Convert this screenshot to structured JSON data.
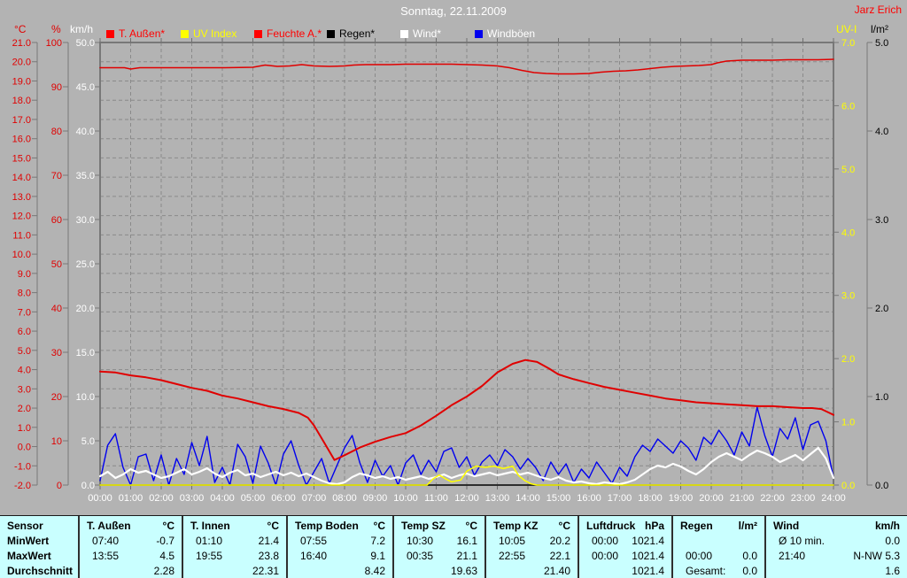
{
  "title": "Sonntag, 22.11.2009",
  "signature": "Jarz Erich",
  "colors": {
    "background": "#b3b3b3",
    "grid": "#8a8a8a",
    "plot_border": "#787878",
    "table_background": "#c9ffff",
    "red": "#e00000",
    "yellow": "#ffff00",
    "white": "#ffffff",
    "blue": "#0000ee",
    "black": "#000000"
  },
  "legend": {
    "items": [
      {
        "label": "T. Außen*",
        "swatch": "#ff0000",
        "text": "#ff0000"
      },
      {
        "label": "UV Index",
        "swatch": "#ffff00",
        "text": "#ffff00"
      },
      {
        "label": "Feuchte A.*",
        "swatch": "#ff0000",
        "text": "#ff0000"
      },
      {
        "label": "Regen*",
        "swatch": "#000000",
        "text": "#000000"
      },
      {
        "label": "Wind*",
        "swatch": "#ffffff",
        "text": "#ffffff"
      },
      {
        "label": "Windböen",
        "swatch": "#0000ee",
        "text": "#ffffff"
      }
    ]
  },
  "chart_data": {
    "type": "line",
    "title": "Sonntag, 22.11.2009",
    "grid": {
      "v_divisions": 24,
      "h_divisions": 23,
      "style": "dashed"
    },
    "x_axis": {
      "min": 0,
      "max": 24,
      "tick_labels": [
        "00:00",
        "01:00",
        "02:00",
        "03:00",
        "04:00",
        "05:00",
        "06:00",
        "07:00",
        "08:00",
        "09:00",
        "10:00",
        "11:00",
        "12:00",
        "13:00",
        "14:00",
        "15:00",
        "16:00",
        "17:00",
        "18:00",
        "19:00",
        "20:00",
        "21:00",
        "22:00",
        "23:00",
        "24:00"
      ]
    },
    "axes": [
      {
        "id": "temp",
        "unit": "°C",
        "color": "#e00000",
        "min": -2,
        "max": 21,
        "ticks": [
          "21.0",
          "20.0",
          "19.0",
          "18.0",
          "17.0",
          "16.0",
          "15.0",
          "14.0",
          "13.0",
          "12.0",
          "11.0",
          "10.0",
          "9.0",
          "8.0",
          "7.0",
          "6.0",
          "5.0",
          "4.0",
          "3.0",
          "2.0",
          "1.0",
          "0.0",
          "-1.0",
          "-2.0"
        ]
      },
      {
        "id": "humidity",
        "unit": "%",
        "color": "#e00000",
        "min": 0,
        "max": 100,
        "ticks": [
          "100",
          "90",
          "80",
          "70",
          "60",
          "50",
          "40",
          "30",
          "20",
          "10",
          "0"
        ]
      },
      {
        "id": "wind",
        "unit": "km/h",
        "color": "#ffffff",
        "min": 0,
        "max": 50,
        "ticks": [
          "50.0",
          "45.0",
          "40.0",
          "35.0",
          "30.0",
          "25.0",
          "20.0",
          "15.0",
          "10.0",
          "5.0",
          "0.0"
        ]
      },
      {
        "id": "uv",
        "unit": "UV-I",
        "color": "#ffff00",
        "min": 0,
        "max": 7,
        "ticks": [
          "7.0",
          "6.0",
          "5.0",
          "4.0",
          "3.0",
          "2.0",
          "1.0",
          "0.0"
        ]
      },
      {
        "id": "rain",
        "unit": "l/m²",
        "color": "#000000",
        "min": 0,
        "max": 5,
        "ticks": [
          "5.0",
          "4.0",
          "3.0",
          "2.0",
          "1.0",
          "0.0"
        ]
      }
    ],
    "series": [
      {
        "name": "Regen*",
        "axis": "rain",
        "color": "#000000",
        "width": 1.2,
        "points": [
          [
            0,
            0
          ],
          [
            24,
            0
          ]
        ]
      },
      {
        "name": "Windböen",
        "axis": "wind",
        "color": "#0000ee",
        "width": 1.4,
        "start": 0,
        "step": 0.25,
        "values": [
          0.5,
          4.5,
          5.8,
          2.0,
          0.0,
          3.2,
          3.5,
          0.5,
          3.4,
          0.0,
          3.0,
          1.2,
          4.8,
          2.2,
          5.5,
          0.3,
          2.0,
          0.0,
          4.6,
          3.2,
          0.2,
          4.4,
          2.5,
          0.0,
          3.5,
          5.0,
          2.2,
          0.0,
          1.5,
          3.0,
          0.2,
          2.2,
          4.2,
          5.6,
          2.5,
          0.3,
          2.8,
          1.0,
          2.2,
          0.0,
          2.5,
          3.4,
          1.2,
          2.8,
          1.5,
          3.8,
          4.2,
          2.0,
          3.2,
          1.1,
          2.6,
          3.4,
          2.2,
          4.0,
          3.2,
          1.8,
          3.0,
          2.0,
          0.5,
          2.6,
          1.2,
          2.4,
          0.3,
          1.8,
          0.8,
          2.6,
          1.4,
          0.2,
          2.0,
          1.0,
          3.2,
          4.5,
          3.8,
          5.2,
          4.4,
          3.6,
          5.0,
          4.2,
          2.8,
          5.4,
          4.6,
          6.2,
          5.0,
          3.4,
          6.0,
          4.4,
          8.8,
          5.6,
          3.2,
          6.4,
          5.2,
          7.6,
          4.0,
          6.8,
          7.2,
          5.0,
          0.8
        ]
      },
      {
        "name": "Wind*",
        "axis": "wind",
        "color": "#ffffff",
        "width": 2.2,
        "start": 0,
        "step": 0.25,
        "values": [
          1.0,
          1.5,
          0.8,
          1.2,
          1.8,
          1.4,
          1.6,
          1.2,
          0.8,
          1.0,
          1.4,
          1.8,
          1.2,
          1.5,
          1.9,
          1.3,
          0.9,
          1.4,
          1.7,
          1.1,
          1.3,
          0.9,
          1.2,
          1.5,
          1.1,
          1.4,
          1.0,
          1.3,
          0.9,
          0.5,
          0.2,
          0.1,
          0.3,
          0.9,
          1.3,
          1.1,
          0.8,
          1.0,
          0.7,
          0.9,
          0.6,
          0.8,
          1.0,
          0.7,
          0.9,
          1.2,
          0.8,
          1.1,
          1.3,
          1.0,
          1.2,
          1.4,
          1.1,
          1.3,
          1.5,
          1.2,
          1.4,
          1.1,
          0.8,
          0.6,
          0.9,
          0.5,
          0.3,
          0.4,
          0.2,
          0.1,
          0.3,
          0.2,
          0.1,
          0.3,
          0.6,
          1.2,
          1.8,
          2.2,
          2.0,
          2.4,
          2.1,
          1.6,
          1.2,
          1.8,
          2.6,
          3.2,
          3.6,
          3.2,
          2.8,
          3.4,
          3.9,
          3.6,
          3.2,
          2.6,
          3.0,
          3.4,
          2.8,
          3.5,
          4.2,
          3.0,
          0.8
        ]
      },
      {
        "name": "UV Index",
        "axis": "uv",
        "color": "#ffff00",
        "width": 1.5,
        "points": [
          [
            0,
            0
          ],
          [
            10.7,
            0
          ],
          [
            10.9,
            0.1
          ],
          [
            11.1,
            0.16
          ],
          [
            11.3,
            0.1
          ],
          [
            11.5,
            0.05
          ],
          [
            11.8,
            0.08
          ],
          [
            12,
            0.22
          ],
          [
            12.3,
            0.3
          ],
          [
            12.6,
            0.28
          ],
          [
            12.9,
            0.3
          ],
          [
            13.2,
            0.26
          ],
          [
            13.5,
            0.3
          ],
          [
            13.7,
            0.15
          ],
          [
            13.9,
            0.07
          ],
          [
            14.1,
            0.02
          ],
          [
            14.3,
            0
          ],
          [
            24,
            0
          ]
        ]
      },
      {
        "name": "Feuchte A.*",
        "axis": "humidity",
        "color": "#e00000",
        "width": 1.5,
        "points": [
          [
            0,
            94.3
          ],
          [
            0.8,
            94.3
          ],
          [
            1,
            94.0
          ],
          [
            1.3,
            94.3
          ],
          [
            2,
            94.3
          ],
          [
            3,
            94.3
          ],
          [
            4,
            94.3
          ],
          [
            5,
            94.4
          ],
          [
            5.4,
            94.9
          ],
          [
            5.8,
            94.6
          ],
          [
            6.2,
            94.7
          ],
          [
            6.6,
            95.0
          ],
          [
            7,
            94.7
          ],
          [
            7.5,
            94.6
          ],
          [
            8,
            94.7
          ],
          [
            8.3,
            94.9
          ],
          [
            8.7,
            95.0
          ],
          [
            9,
            95.0
          ],
          [
            9.5,
            95.0
          ],
          [
            10,
            95.1
          ],
          [
            10.5,
            95.1
          ],
          [
            11,
            95.1
          ],
          [
            11.5,
            95.1
          ],
          [
            12,
            95.0
          ],
          [
            12.5,
            94.9
          ],
          [
            13,
            94.7
          ],
          [
            13.4,
            94.3
          ],
          [
            13.8,
            93.7
          ],
          [
            14.2,
            93.2
          ],
          [
            14.6,
            93.0
          ],
          [
            15,
            92.9
          ],
          [
            15.5,
            92.9
          ],
          [
            16,
            93.0
          ],
          [
            16.4,
            93.3
          ],
          [
            16.8,
            93.5
          ],
          [
            17.2,
            93.6
          ],
          [
            17.6,
            93.8
          ],
          [
            18,
            94.1
          ],
          [
            18.4,
            94.4
          ],
          [
            18.8,
            94.6
          ],
          [
            19.2,
            94.7
          ],
          [
            19.6,
            94.8
          ],
          [
            20,
            95.0
          ],
          [
            20.2,
            95.4
          ],
          [
            20.5,
            95.8
          ],
          [
            21,
            96.0
          ],
          [
            21.5,
            96.0
          ],
          [
            22,
            96.0
          ],
          [
            22.5,
            96.1
          ],
          [
            23,
            96.1
          ],
          [
            23.5,
            96.1
          ],
          [
            24,
            96.2
          ]
        ]
      },
      {
        "name": "T. Außen*",
        "axis": "temp",
        "color": "#e00000",
        "width": 2,
        "points": [
          [
            0,
            3.9
          ],
          [
            0.5,
            3.85
          ],
          [
            1,
            3.7
          ],
          [
            1.5,
            3.6
          ],
          [
            2,
            3.45
          ],
          [
            2.5,
            3.25
          ],
          [
            3,
            3.05
          ],
          [
            3.5,
            2.9
          ],
          [
            4,
            2.65
          ],
          [
            4.5,
            2.5
          ],
          [
            5,
            2.3
          ],
          [
            5.5,
            2.1
          ],
          [
            6,
            1.95
          ],
          [
            6.5,
            1.75
          ],
          [
            6.8,
            1.5
          ],
          [
            7,
            1.1
          ],
          [
            7.3,
            0.3
          ],
          [
            7.67,
            -0.7
          ],
          [
            8,
            -0.45
          ],
          [
            8.5,
            -0.05
          ],
          [
            9,
            0.25
          ],
          [
            9.5,
            0.5
          ],
          [
            10,
            0.7
          ],
          [
            10.5,
            1.1
          ],
          [
            11,
            1.6
          ],
          [
            11.5,
            2.15
          ],
          [
            12,
            2.6
          ],
          [
            12.5,
            3.15
          ],
          [
            13,
            3.85
          ],
          [
            13.5,
            4.3
          ],
          [
            13.92,
            4.5
          ],
          [
            14.3,
            4.4
          ],
          [
            14.7,
            4.05
          ],
          [
            15,
            3.75
          ],
          [
            15.5,
            3.5
          ],
          [
            16,
            3.3
          ],
          [
            16.5,
            3.1
          ],
          [
            17,
            2.95
          ],
          [
            17.5,
            2.8
          ],
          [
            18,
            2.65
          ],
          [
            18.5,
            2.5
          ],
          [
            19,
            2.4
          ],
          [
            19.5,
            2.3
          ],
          [
            20,
            2.25
          ],
          [
            20.5,
            2.2
          ],
          [
            21,
            2.15
          ],
          [
            21.5,
            2.1
          ],
          [
            22,
            2.1
          ],
          [
            22.5,
            2.05
          ],
          [
            23,
            2.0
          ],
          [
            23.3,
            2.0
          ],
          [
            23.6,
            1.95
          ],
          [
            23.8,
            1.8
          ],
          [
            24,
            1.65
          ]
        ]
      }
    ]
  },
  "table": {
    "row_header": "Sensor",
    "row_labels": [
      "MinWert",
      "MaxWert",
      "Durchschnitt"
    ],
    "columns": [
      {
        "name": "T. Außen",
        "unit": "°C",
        "min": [
          "07:40",
          "-0.7"
        ],
        "max": [
          "13:55",
          "4.5"
        ],
        "avg_label": "",
        "avg": "2.28"
      },
      {
        "name": "T. Innen",
        "unit": "°C",
        "min": [
          "01:10",
          "21.4"
        ],
        "max": [
          "19:55",
          "23.8"
        ],
        "avg_label": "",
        "avg": "22.31"
      },
      {
        "name": "Temp Boden",
        "unit": "°C",
        "min": [
          "07:55",
          "7.2"
        ],
        "max": [
          "16:40",
          "9.1"
        ],
        "avg_label": "",
        "avg": "8.42"
      },
      {
        "name": "Temp SZ",
        "unit": "°C",
        "min": [
          "10:30",
          "16.1"
        ],
        "max": [
          "00:35",
          "21.1"
        ],
        "avg_label": "",
        "avg": "19.63"
      },
      {
        "name": "Temp KZ",
        "unit": "°C",
        "min": [
          "10:05",
          "20.2"
        ],
        "max": [
          "22:55",
          "22.1"
        ],
        "avg_label": "",
        "avg": "21.40"
      },
      {
        "name": "Luftdruck",
        "unit": "hPa",
        "min": [
          "00:00",
          "1021.4"
        ],
        "max": [
          "00:00",
          "1021.4"
        ],
        "avg_label": "",
        "avg": "1021.4"
      },
      {
        "name": "Regen",
        "unit": "l/m²",
        "min": [
          "",
          ""
        ],
        "max": [
          "00:00",
          "0.0"
        ],
        "avg_label": "Gesamt:",
        "avg": "0.0"
      },
      {
        "name": "Wind",
        "unit": "km/h",
        "min": [
          "Ø 10 min.",
          "0.0"
        ],
        "max": [
          "21:40",
          "N-NW 5.3"
        ],
        "avg_label": "",
        "avg": "1.6"
      }
    ]
  }
}
